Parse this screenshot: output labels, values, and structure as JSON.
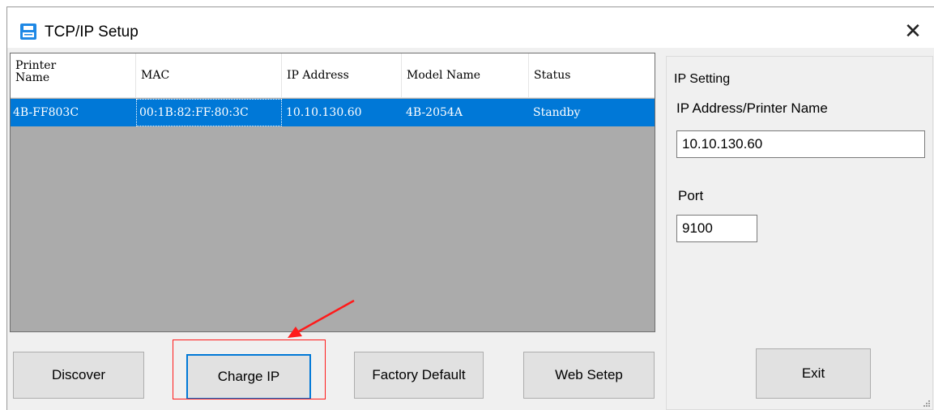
{
  "window": {
    "title": "TCP/IP Setup"
  },
  "list": {
    "columns": [
      {
        "label": "Printer\nName"
      },
      {
        "label": "MAC"
      },
      {
        "label": "IP Address"
      },
      {
        "label": "Model Name"
      },
      {
        "label": "Status"
      }
    ],
    "rows": [
      {
        "printer_name": "4B-FF803C",
        "mac": "00:1B:82:FF:80:3C",
        "ip": "10.10.130.60",
        "model": "4B-2054A",
        "status": "Standby",
        "selected": true
      }
    ]
  },
  "buttons": {
    "discover": "Discover",
    "charge_ip": "Charge IP",
    "factory_default": "Factory Default",
    "web_setep": "Web Setep",
    "exit": "Exit"
  },
  "ip_setting": {
    "group_title": "IP Setting",
    "address_label": "IP Address/Printer Name",
    "address_value": "10.10.130.60",
    "port_label": "Port",
    "port_value": "9100"
  },
  "colors": {
    "selection": "#0078d7",
    "annotation": "#ff1a1a",
    "list_background": "#ababab"
  },
  "icons": {
    "title": "printer-icon",
    "close": "close-icon"
  }
}
